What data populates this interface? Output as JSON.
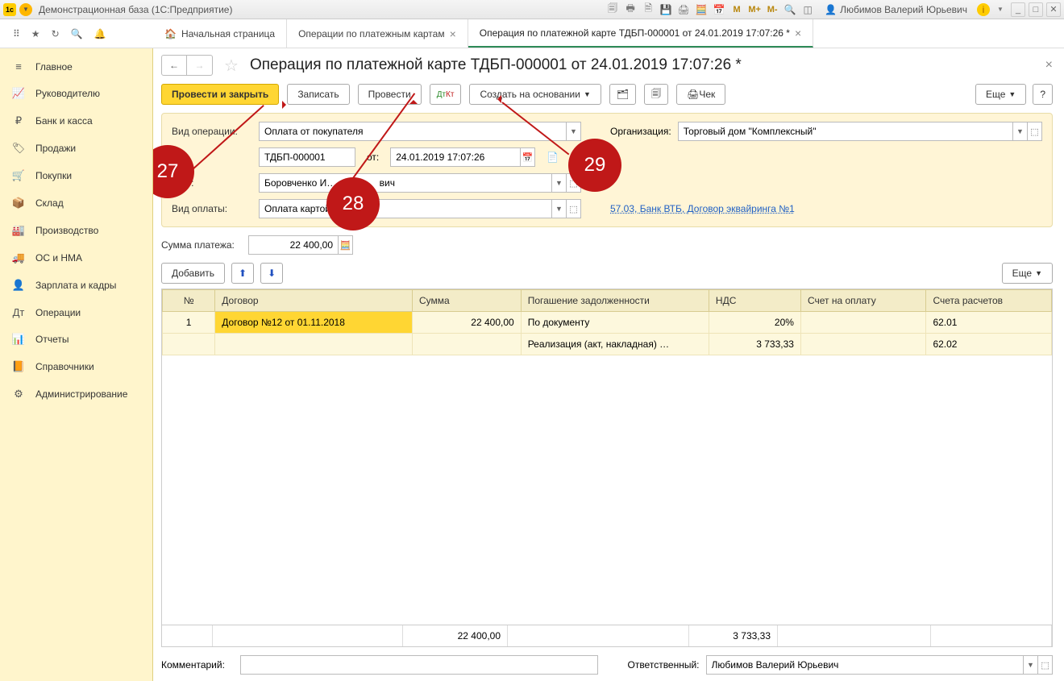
{
  "titlebar": {
    "title": "Демонстрационная база  (1С:Предприятие)",
    "m_labels": [
      "M",
      "M+",
      "M-"
    ],
    "user": "Любимов Валерий Юрьевич"
  },
  "tabs": {
    "home": "Начальная страница",
    "t1": "Операции по платежным картам",
    "t2": "Операция по платежной карте ТДБП-000001 от 24.01.2019 17:07:26 *"
  },
  "sidebar": {
    "items": [
      {
        "icon": "≡",
        "label": "Главное"
      },
      {
        "icon": "📈",
        "label": "Руководителю"
      },
      {
        "icon": "₽",
        "label": "Банк и касса"
      },
      {
        "icon": "🏷",
        "label": "Продажи"
      },
      {
        "icon": "🛒",
        "label": "Покупки"
      },
      {
        "icon": "📦",
        "label": "Склад"
      },
      {
        "icon": "🏭",
        "label": "Производство"
      },
      {
        "icon": "🚚",
        "label": "ОС и НМА"
      },
      {
        "icon": "👤",
        "label": "Зарплата и кадры"
      },
      {
        "icon": "Дт",
        "label": "Операции"
      },
      {
        "icon": "📊",
        "label": "Отчеты"
      },
      {
        "icon": "📙",
        "label": "Справочники"
      },
      {
        "icon": "⚙",
        "label": "Администрирование"
      }
    ]
  },
  "page": {
    "title": "Операция по платежной карте ТДБП-000001 от 24.01.2019 17:07:26 *"
  },
  "actions": {
    "post_close": "Провести и закрыть",
    "save": "Записать",
    "post": "Провести",
    "create_based": "Создать на основании",
    "receipt": "Чек",
    "more": "Еще",
    "help": "?"
  },
  "form": {
    "op_type_label": "Вид операции:",
    "op_type": "Оплата от покупателя",
    "org_label": "Организация:",
    "org": "Торговый дом \"Комплексный\"",
    "number": "ТДБП-000001",
    "date_label": "от:",
    "date": "24.01.2019 17:07:26",
    "counterparty_label": "Контрагент:",
    "counterparty": "Боровченко И…                вич",
    "pay_type_label": "Вид оплаты:",
    "pay_type": "Оплата картой …",
    "pay_link": "57.03, Банк ВТБ, Договор эквайринга №1",
    "sum_label": "Сумма платежа:",
    "sum": "22 400,00"
  },
  "grid": {
    "add": "Добавить",
    "more": "Еще",
    "headers": [
      "№",
      "Договор",
      "Сумма",
      "Погашение задолженности",
      "НДС",
      "Счет на оплату",
      "Счета расчетов"
    ],
    "rows": [
      {
        "n": "1",
        "contract": "Договор №12 от 01.11.2018",
        "sum": "22 400,00",
        "pay": "По документу",
        "vat": "20%",
        "invoice": "",
        "acc": "62.01"
      },
      {
        "n": "",
        "contract": "",
        "sum": "",
        "pay": "Реализация (акт, накладная) …",
        "vat": "3 733,33",
        "invoice": "",
        "acc": "62.02"
      }
    ],
    "footer_sum": "22 400,00",
    "footer_vat": "3 733,33"
  },
  "footer": {
    "comment_label": "Комментарий:",
    "resp_label": "Ответственный:",
    "resp": "Любимов Валерий Юрьевич"
  },
  "callouts": {
    "c27": "27",
    "c28": "28",
    "c29": "29"
  }
}
